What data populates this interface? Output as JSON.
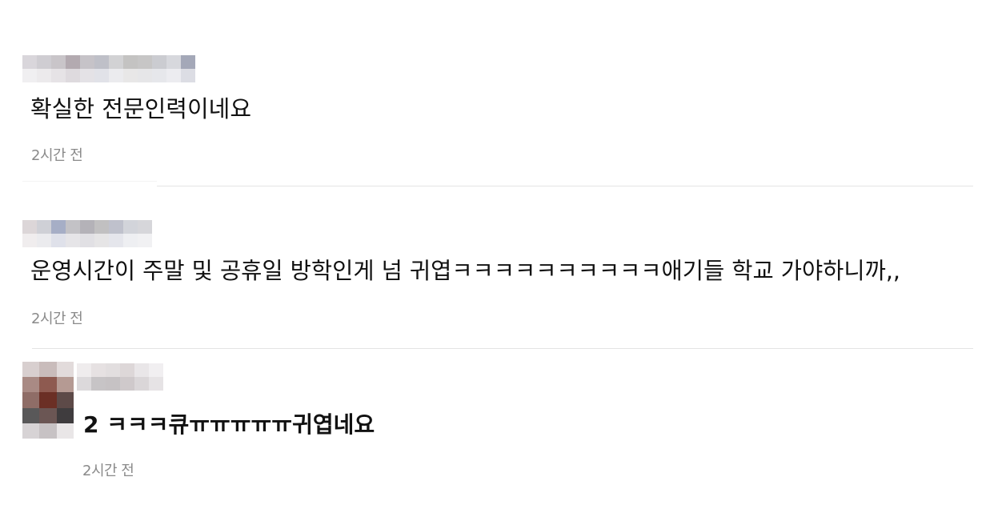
{
  "comments": [
    {
      "text": "확실한 전문인력이네요",
      "time": "2시간 전"
    },
    {
      "text": "운영시간이 주말 및 공휴일 방학인게 넘 귀엽ㅋㅋㅋㅋㅋㅋㅋㅋㅋㅋ애기들 학교 가야하니까,,",
      "time": "2시간 전"
    },
    {
      "text": "2 ㅋㅋㅋ큐ㅠㅠㅠㅠㅠ귀엽네요",
      "time": "2시간 전"
    }
  ],
  "colors": {
    "divider": "#e4e4e4",
    "timestamp": "#8a8a8a",
    "text": "#111111"
  }
}
